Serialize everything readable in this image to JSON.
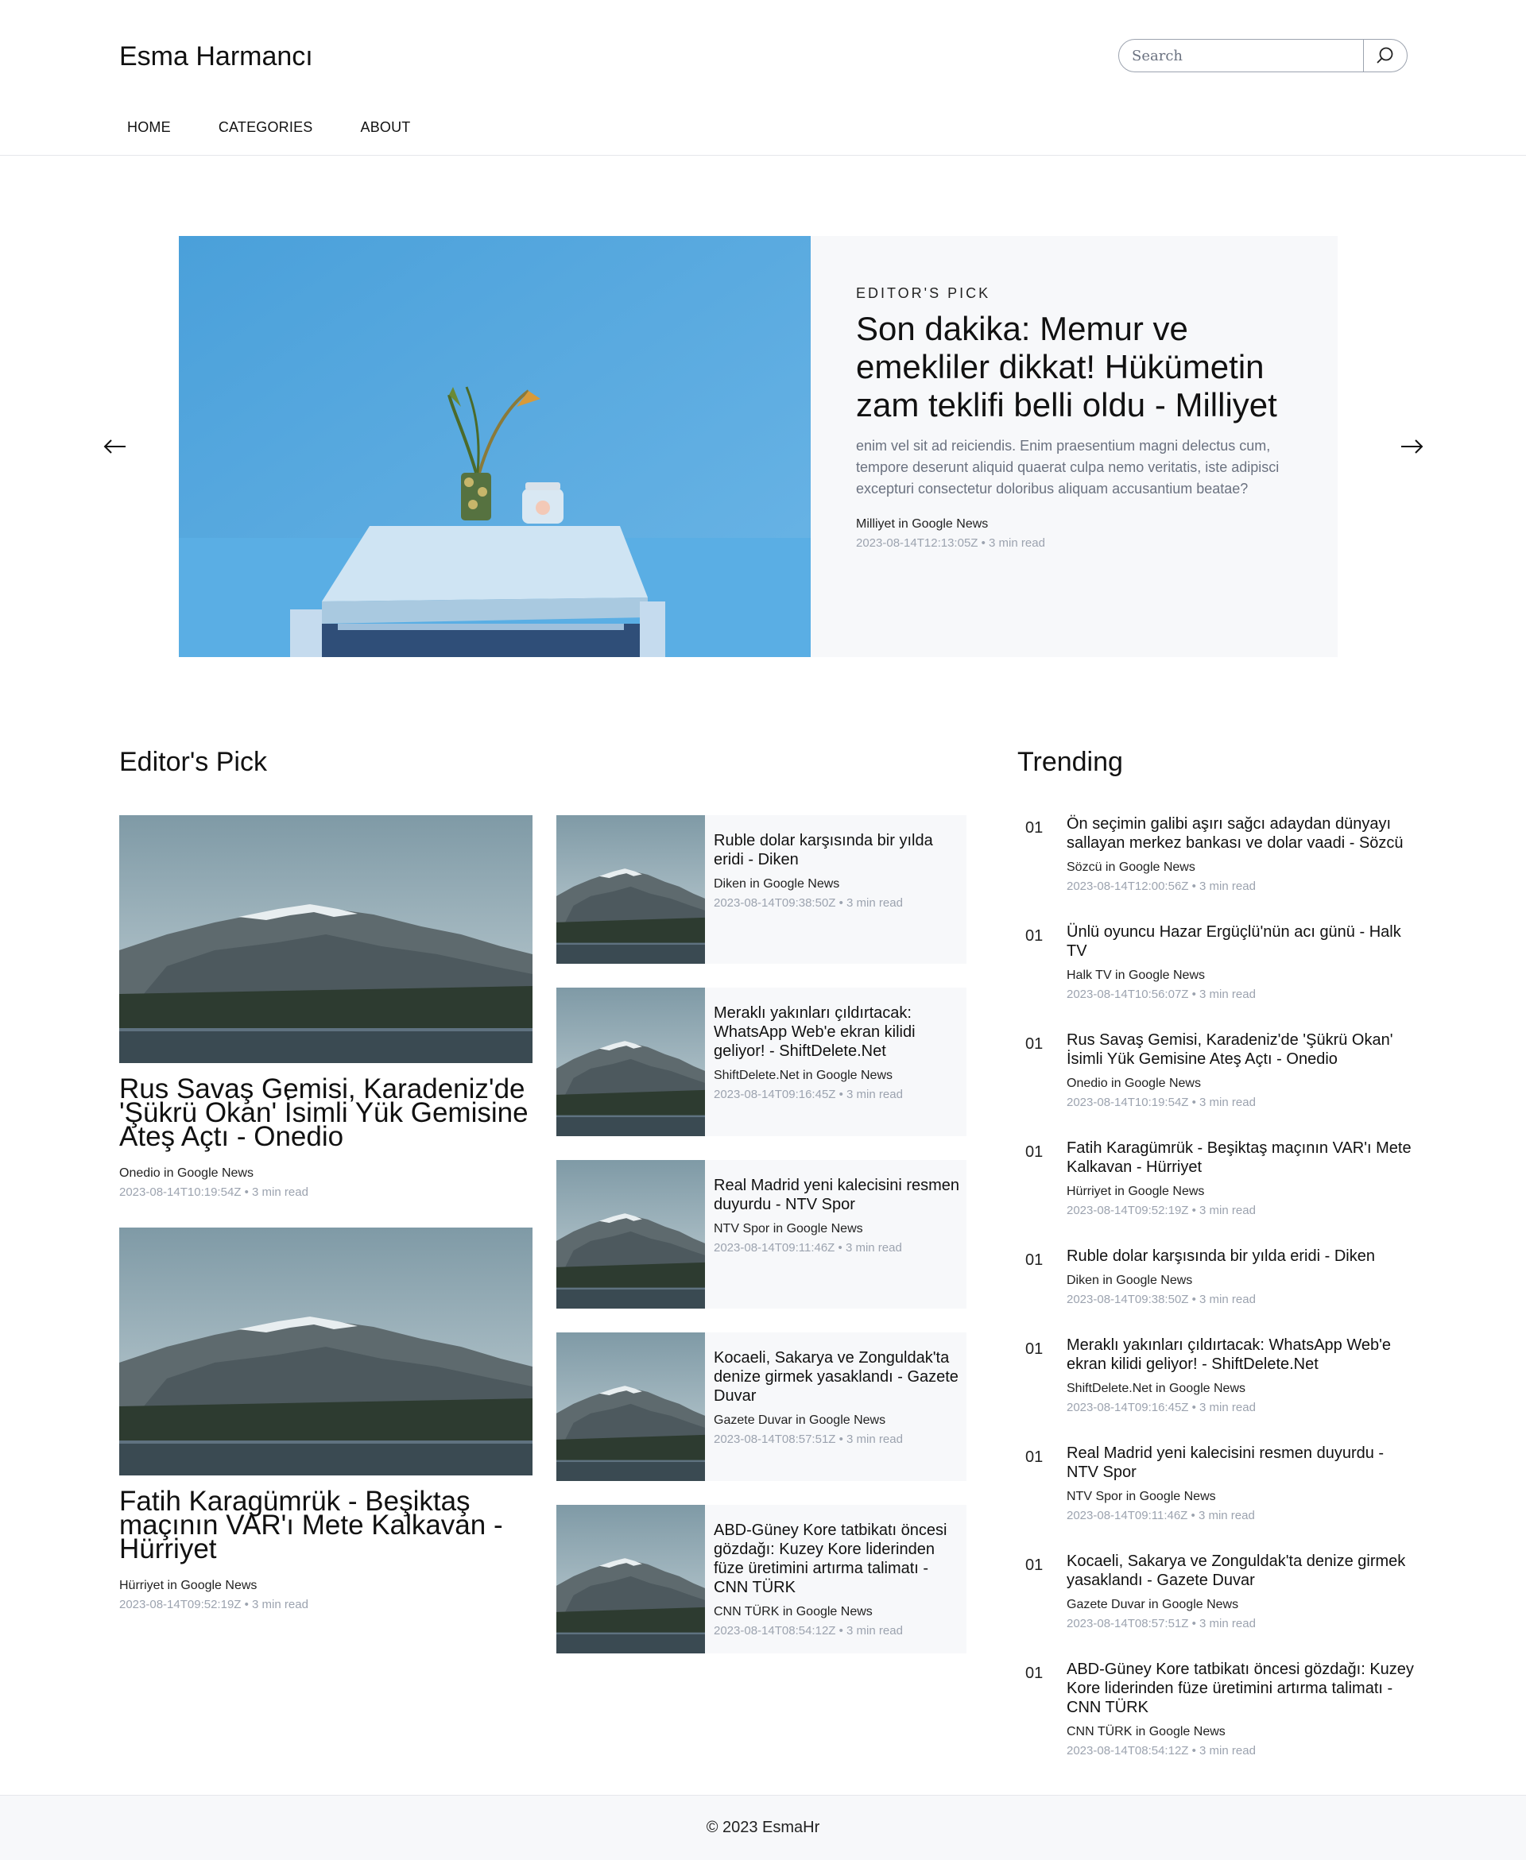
{
  "header": {
    "brand": "Esma Harmancı",
    "search_placeholder": "Search",
    "nav": [
      "HOME",
      "CATEGORIES",
      "ABOUT"
    ]
  },
  "hero": {
    "kicker": "EDITOR'S PICK",
    "title": "Son dakika: Memur ve emekliler dikkat! Hükümetin zam teklifi belli oldu - Milliyet",
    "description": "enim vel sit ad reiciendis. Enim praesentium magni delectus cum, tempore deserunt aliquid quaerat culpa nemo veritatis, iste adipisci excepturi consectetur doloribus aliquam accusantium beatae?",
    "source": "Milliyet in Google News",
    "date": "2023-08-14T12:13:05Z",
    "read": "3 min read"
  },
  "editors_pick": {
    "title": "Editor's Pick",
    "big": [
      {
        "title": "Rus Savaş Gemisi, Karadeniz'de 'Şükrü Okan' İsimli Yük Gemisine Ateş Açtı - Onedio",
        "source": "Onedio in Google News",
        "date": "2023-08-14T10:19:54Z",
        "read": "3 min read"
      },
      {
        "title": "Fatih Karagümrük - Beşiktaş maçının VAR'ı Mete Kalkavan - Hürriyet",
        "source": "Hürriyet in Google News",
        "date": "2023-08-14T09:52:19Z",
        "read": "3 min read"
      }
    ],
    "small": [
      {
        "title": "Ruble dolar karşısında bir yılda eridi - Diken",
        "source": "Diken in Google News",
        "date": "2023-08-14T09:38:50Z",
        "read": "3 min read"
      },
      {
        "title": "Meraklı yakınları çıldırtacak: WhatsApp Web'e ekran kilidi geliyor! - ShiftDelete.Net",
        "source": "ShiftDelete.Net in Google News",
        "date": "2023-08-14T09:16:45Z",
        "read": "3 min read"
      },
      {
        "title": "Real Madrid yeni kalecisini resmen duyurdu - NTV Spor",
        "source": "NTV Spor in Google News",
        "date": "2023-08-14T09:11:46Z",
        "read": "3 min read"
      },
      {
        "title": "Kocaeli, Sakarya ve Zonguldak'ta denize girmek yasaklandı - Gazete Duvar",
        "source": "Gazete Duvar in Google News",
        "date": "2023-08-14T08:57:51Z",
        "read": "3 min read"
      },
      {
        "title": "ABD-Güney Kore tatbikatı öncesi gözdağı: Kuzey Kore liderinden füze üretimini artırma talimatı - CNN TÜRK",
        "source": "CNN TÜRK in Google News",
        "date": "2023-08-14T08:54:12Z",
        "read": "3 min read"
      }
    ]
  },
  "trending": {
    "title": "Trending",
    "items": [
      {
        "num": "01",
        "title": "Ön seçimin galibi aşırı sağcı adaydan dünyayı sallayan merkez bankası ve dolar vaadi - Sözcü",
        "source": "Sözcü in Google News",
        "date": "2023-08-14T12:00:56Z",
        "read": "3 min read"
      },
      {
        "num": "01",
        "title": "Ünlü oyuncu Hazar Ergüçlü'nün acı günü - Halk TV",
        "source": "Halk TV in Google News",
        "date": "2023-08-14T10:56:07Z",
        "read": "3 min read"
      },
      {
        "num": "01",
        "title": "Rus Savaş Gemisi, Karadeniz'de 'Şükrü Okan' İsimli Yük Gemisine Ateş Açtı - Onedio",
        "source": "Onedio in Google News",
        "date": "2023-08-14T10:19:54Z",
        "read": "3 min read"
      },
      {
        "num": "01",
        "title": "Fatih Karagümrük - Beşiktaş maçının VAR'ı Mete Kalkavan - Hürriyet",
        "source": "Hürriyet in Google News",
        "date": "2023-08-14T09:52:19Z",
        "read": "3 min read"
      },
      {
        "num": "01",
        "title": "Ruble dolar karşısında bir yılda eridi - Diken",
        "source": "Diken in Google News",
        "date": "2023-08-14T09:38:50Z",
        "read": "3 min read"
      },
      {
        "num": "01",
        "title": "Meraklı yakınları çıldırtacak: WhatsApp Web'e ekran kilidi geliyor! - ShiftDelete.Net",
        "source": "ShiftDelete.Net in Google News",
        "date": "2023-08-14T09:16:45Z",
        "read": "3 min read"
      },
      {
        "num": "01",
        "title": "Real Madrid yeni kalecisini resmen duyurdu - NTV Spor",
        "source": "NTV Spor in Google News",
        "date": "2023-08-14T09:11:46Z",
        "read": "3 min read"
      },
      {
        "num": "01",
        "title": "Kocaeli, Sakarya ve Zonguldak'ta denize girmek yasaklandı - Gazete Duvar",
        "source": "Gazete Duvar in Google News",
        "date": "2023-08-14T08:57:51Z",
        "read": "3 min read"
      },
      {
        "num": "01",
        "title": "ABD-Güney Kore tatbikatı öncesi gözdağı: Kuzey Kore liderinden füze üretimini artırma talimatı - CNN TÜRK",
        "source": "CNN TÜRK in Google News",
        "date": "2023-08-14T08:54:12Z",
        "read": "3 min read"
      }
    ]
  },
  "footer": {
    "text": "© 2023 EsmaHr"
  },
  "colors": {
    "hero_bg": "#f7f8fa",
    "card_bg": "#f7f8fa",
    "muted": "#9ca3af",
    "wall_blue": "#5aa9de"
  }
}
